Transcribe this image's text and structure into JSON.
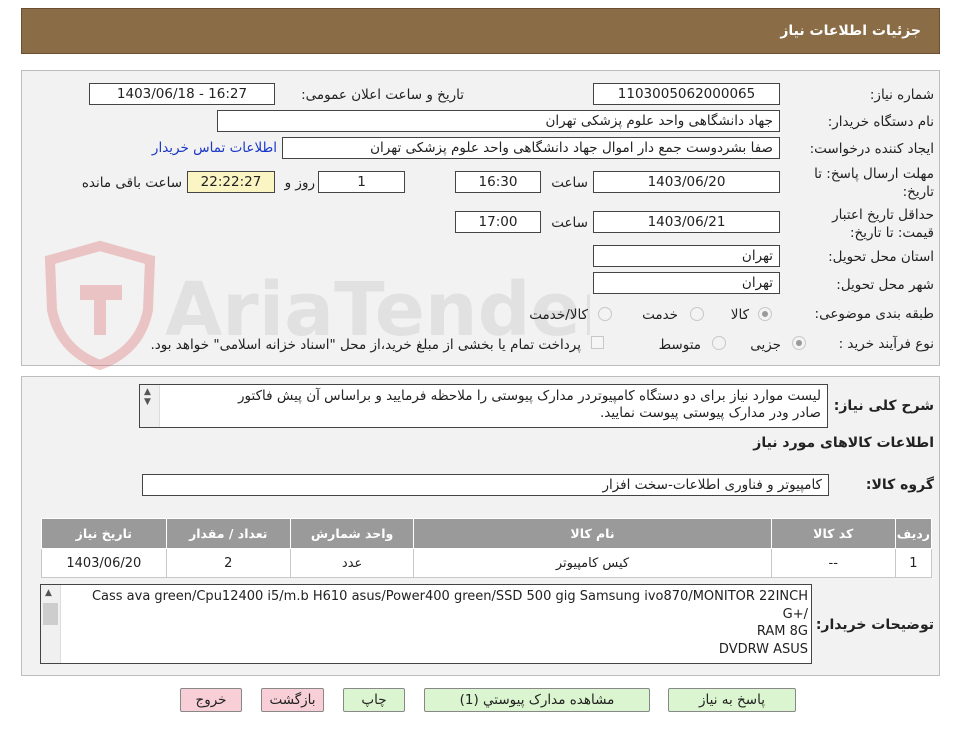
{
  "header": {
    "title": "جزئیات اطلاعات نیاز"
  },
  "fields": {
    "need_number_label": "شماره نیاز:",
    "need_number": "1103005062000065",
    "announce_label": "تاریخ و ساعت اعلان عمومی:",
    "announce_value": "1403/06/18 - 16:27",
    "buyer_org_label": "نام دستگاه خریدار:",
    "buyer_org": "جهاد دانشگاهی واحد علوم پزشکی تهران",
    "creator_label": "ایجاد کننده درخواست:",
    "creator": "صفا بشردوست جمع دار اموال  جهاد دانشگاهی واحد علوم پزشکی تهران",
    "contact_link": "اطلاعات تماس خریدار",
    "deadline_label": "مهلت ارسال پاسخ: تا تاریخ:",
    "deadline_date": "1403/06/20",
    "time_label": "ساعت",
    "deadline_time": "16:30",
    "days": "1",
    "days_label": "روز و",
    "remaining": "22:22:27",
    "remaining_label": "ساعت باقی مانده",
    "validity_label": "حداقل تاریخ اعتبار قیمت: تا تاریخ:",
    "validity_date": "1403/06/21",
    "validity_time": "17:00",
    "province_label": "استان محل تحویل:",
    "province": "تهران",
    "city_label": "شهر محل تحویل:",
    "city": "تهران",
    "category_label": "طبقه بندی موضوعی:",
    "category_options": [
      "کالا",
      "خدمت",
      "کالا/خدمت"
    ],
    "process_label": "نوع فرآیند خرید :",
    "process_options": [
      "جزیی",
      "متوسط"
    ],
    "payment_note": "پرداخت تمام یا بخشی از مبلغ خرید،از محل \"اسناد خزانه اسلامی\" خواهد بود."
  },
  "watermark": {
    "text": "AriaTender.neT"
  },
  "details": {
    "summary_label": "شرح کلی نیاز:",
    "summary_line1": "لیست موارد نیاز برای دو دستگاه کامپیوتردر مدارک پیوستی را ملاحظه فرمایید و براساس آن پیش فاکتور",
    "summary_line2": "صادر ودر مدارک پیوستی پیوست نمایید.",
    "goods_info_title": "اطلاعات کالاهای مورد نیاز",
    "goods_group_label": "گروه کالا:",
    "goods_group": "کامپیوتر و فناوری اطلاعات-سخت افزار",
    "table": {
      "headers": [
        "ردیف",
        "کد کالا",
        "نام کالا",
        "واحد شمارش",
        "تعداد / مقدار",
        "تاریخ نیاز"
      ],
      "rows": [
        [
          "1",
          "--",
          "کیس کامپیوتر",
          "عدد",
          "2",
          "1403/06/20"
        ]
      ]
    },
    "buyer_notes_label": "توضیحات خریدار:",
    "buyer_notes": [
      "Cass ava green/Cpu12400 i5/m.b H610 asus/Power400 green/SSD 500 gig  Samsung ivo870/MONITOR 22INCH",
      "G+/",
      "RAM 8G",
      "DVDRW ASUS"
    ]
  },
  "buttons": {
    "reply": "پاسخ به نیاز",
    "attachments": "مشاهده مدارک پیوستي (1)",
    "print": "چاپ",
    "back": "بازگشت",
    "exit": "خروج"
  },
  "colors": {
    "header_bg": "#8a6c46",
    "panel_bg": "#f2f2f2",
    "remaining_bg": "#fbf5c4",
    "link": "#1a37c8",
    "table_header": "#9a9a9a",
    "btn_green": "#daf5cf",
    "btn_pink": "#f8cfd6"
  }
}
